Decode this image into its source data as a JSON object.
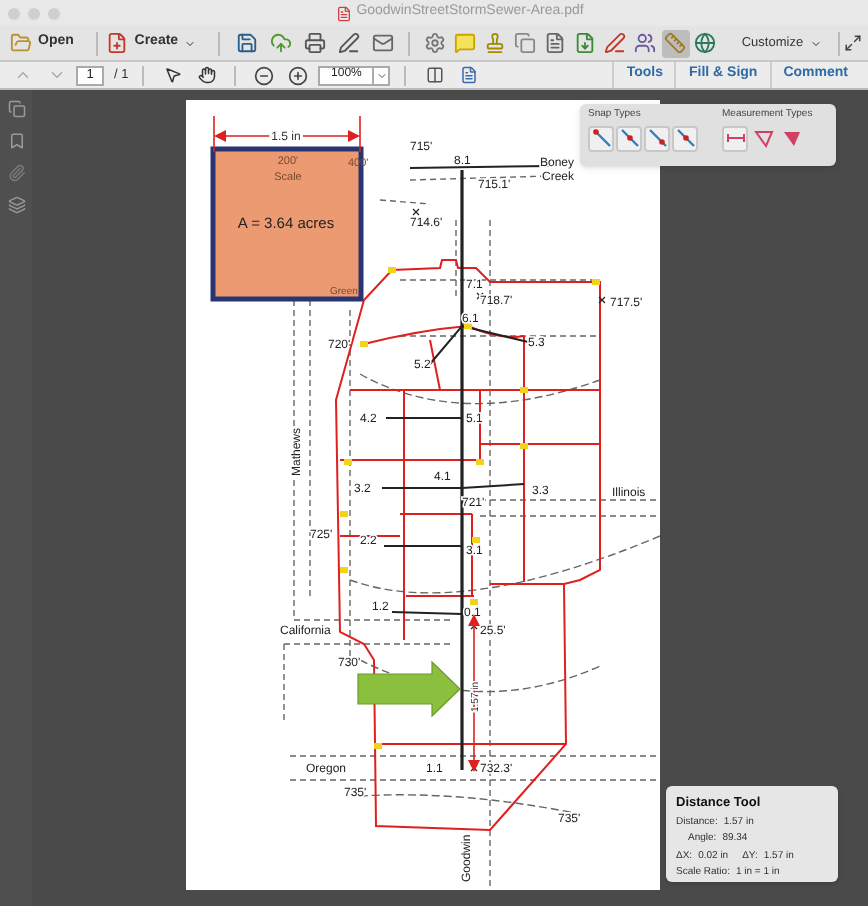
{
  "window": {
    "title": "GoodwinStreetStormSewer-Area.pdf"
  },
  "toolbar": {
    "open": "Open",
    "create": "Create",
    "customize": "Customize"
  },
  "nav": {
    "page": "1",
    "page_total": "/ 1",
    "zoom": "100%"
  },
  "panel_tabs": [
    {
      "label": "Tools",
      "selected": false
    },
    {
      "label": "Fill & Sign",
      "selected": false
    },
    {
      "label": "Comment",
      "selected": false
    }
  ],
  "document": {
    "scale": {
      "length": "1.5 in",
      "left_mark": "200'",
      "word": "Scale",
      "right_mark": "400'",
      "area": "A = 3.64 acres",
      "corner": "Green"
    },
    "measurement": "1.57 in",
    "labels": [
      "715'",
      "8.1",
      "Boney",
      "Creek",
      "715.1'",
      "714.6'",
      "7.1",
      "718.7'",
      "717.5'",
      "6.1",
      "5.3",
      "720'",
      "5.2",
      "4.2",
      "5.1",
      "3.2",
      "4.1",
      "3.3",
      "721'",
      "Illinois",
      "Mathews",
      "725'",
      "2.2",
      "3.1",
      "1.2",
      "0.1",
      "25.5'",
      "California",
      "730'",
      "Oregon",
      "1.1",
      "732.3'",
      "735'",
      "735'",
      "Goodwin"
    ]
  },
  "snap_panel": {
    "snap_title": "Snap Types",
    "measure_title": "Measurement Types",
    "snap_types": [
      {
        "selected": true
      },
      {
        "selected": true
      },
      {
        "selected": true
      },
      {
        "selected": true
      }
    ],
    "measurement_types": [
      {
        "selected": true
      },
      {
        "selected": false
      },
      {
        "selected": false
      }
    ]
  },
  "distance_tool": {
    "title": "Distance Tool",
    "distance_label": "Distance:",
    "distance": "1.57 in",
    "angle_label": "Angle:",
    "angle": "89.34",
    "dx_label": "ΔX:",
    "dx": "0.02 in",
    "dy_label": "ΔY:",
    "dy": "1.57 in",
    "ratio_label": "Scale Ratio:",
    "ratio": "1 in = 1 in"
  }
}
